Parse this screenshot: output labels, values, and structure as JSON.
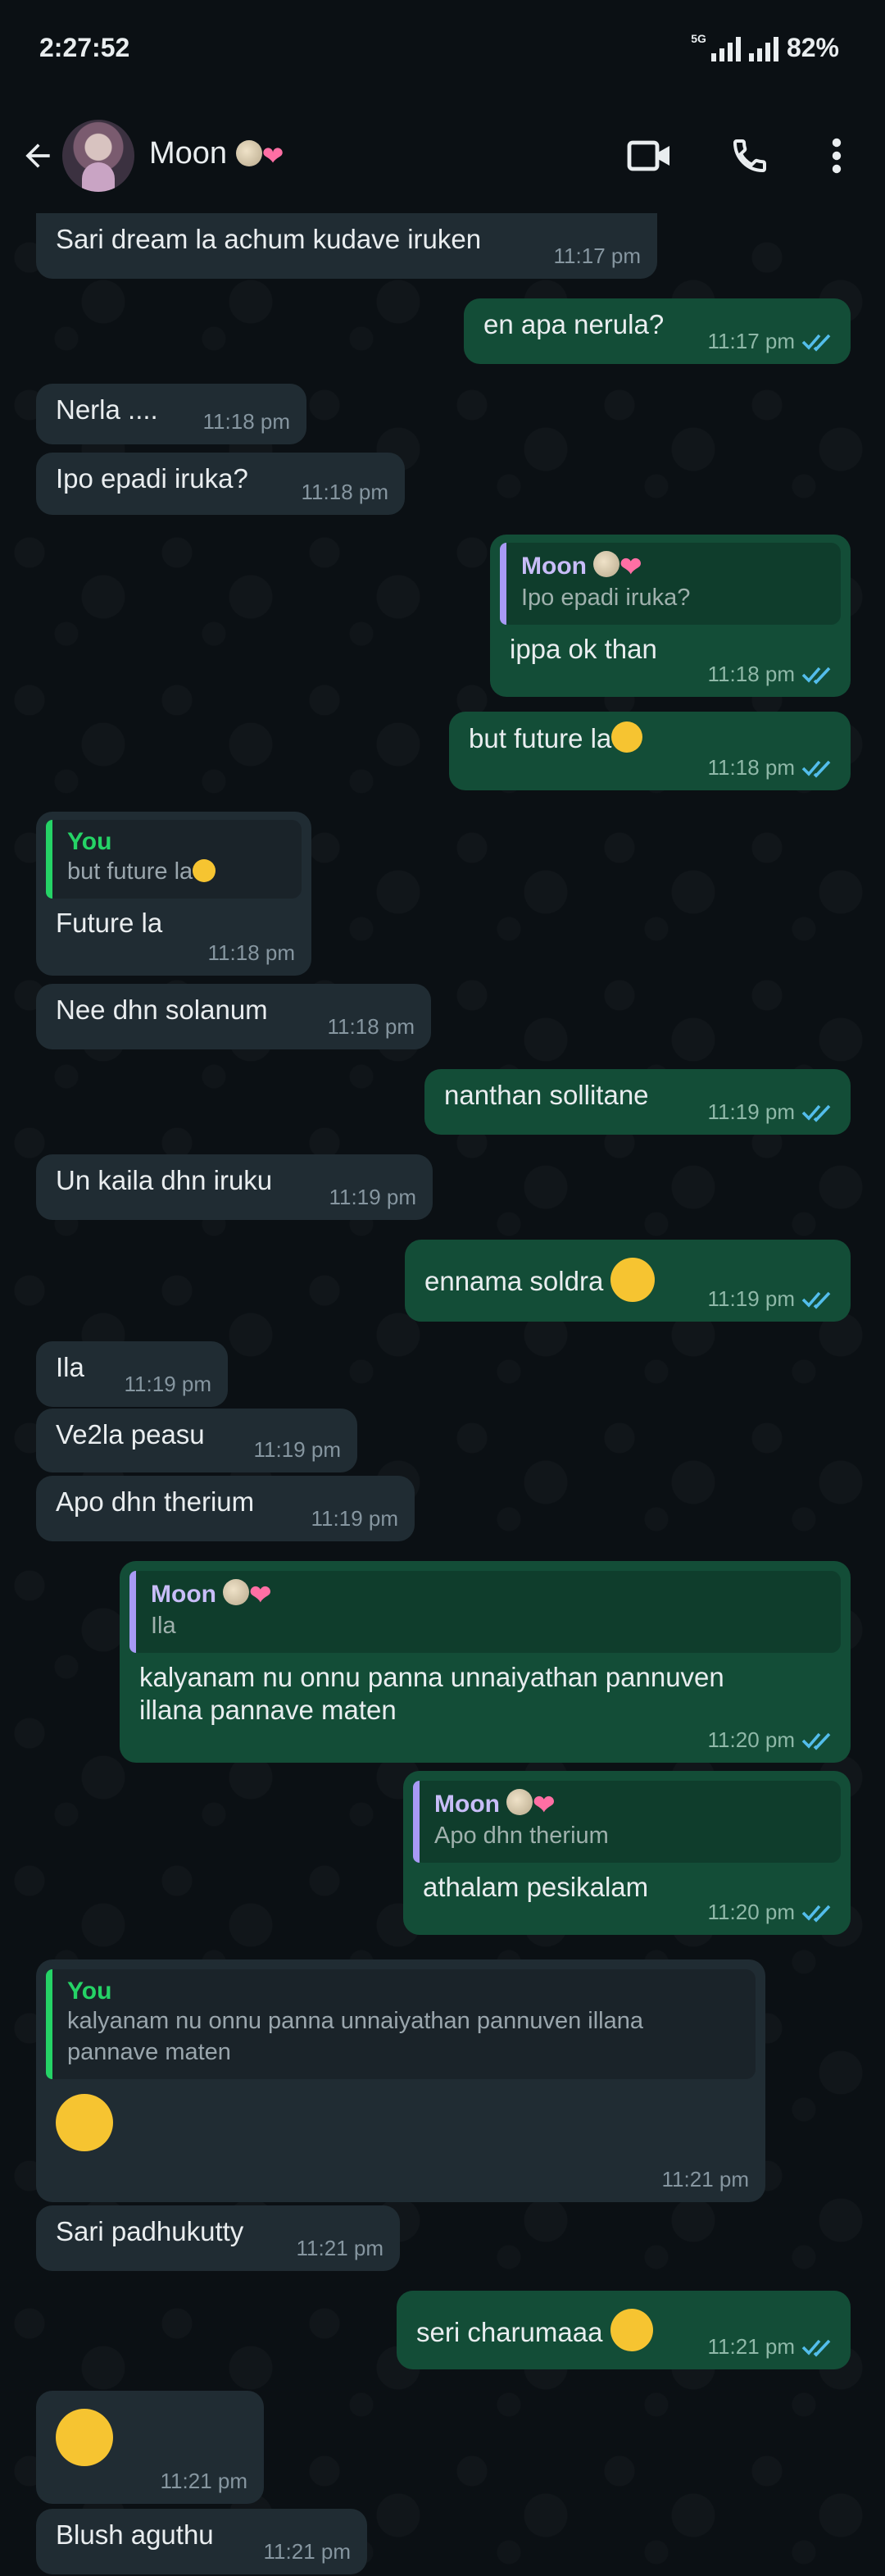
{
  "status": {
    "time": "2:27:52",
    "network": "5G",
    "battery": "82%"
  },
  "header": {
    "contact_name": "Moon",
    "contact_emojis": [
      "moon-emoji",
      "sparkling-heart-emoji"
    ]
  },
  "messages": [
    {
      "dir": "in",
      "text": "Sari dream la achum kudave iruken",
      "time": "11:17 pm"
    },
    {
      "dir": "out",
      "text": "en apa nerula?",
      "time": "11:17 pm"
    },
    {
      "dir": "in",
      "text": "Nerla ....",
      "time": "11:18 pm"
    },
    {
      "dir": "in",
      "text": "Ipo epadi iruka?",
      "time": "11:18 pm"
    },
    {
      "dir": "out",
      "quote_name": "Moon",
      "quote_text": "Ipo epadi iruka?",
      "text": "ippa ok than",
      "time": "11:18 pm"
    },
    {
      "dir": "out",
      "text": "but future la",
      "time": "11:18 pm"
    },
    {
      "dir": "in",
      "quote_name": "You",
      "quote_text": "but future la",
      "text": "Future la",
      "time": "11:18 pm"
    },
    {
      "dir": "in",
      "text": "Nee dhn solanum",
      "time": "11:18 pm"
    },
    {
      "dir": "out",
      "text": "nanthan sollitane",
      "time": "11:19 pm"
    },
    {
      "dir": "in",
      "text": "Un kaila dhn iruku",
      "time": "11:19 pm"
    },
    {
      "dir": "out",
      "text": "ennama soldra",
      "time": "11:19 pm"
    },
    {
      "dir": "in",
      "text": "Ila",
      "time": "11:19 pm"
    },
    {
      "dir": "in",
      "text": "Ve2la peasu",
      "time": "11:19 pm"
    },
    {
      "dir": "in",
      "text": "Apo dhn therium",
      "time": "11:19 pm"
    },
    {
      "dir": "out",
      "quote_name": "Moon",
      "quote_text": "Ila",
      "text": "kalyanam nu onnu panna unnaiyathan pannuven illana pannave maten",
      "time": "11:20 pm"
    },
    {
      "dir": "out",
      "quote_name": "Moon",
      "quote_text": "Apo dhn therium",
      "text": "athalam pesikalam",
      "time": "11:20 pm"
    },
    {
      "dir": "in",
      "quote_name": "You",
      "quote_text": "kalyanam nu onnu panna unnaiyathan pannuven illana pannave maten",
      "text": "",
      "time": "11:21 pm"
    },
    {
      "dir": "in",
      "text": "Sari padhukutty",
      "time": "11:21 pm"
    },
    {
      "dir": "out",
      "text": "seri charumaaa",
      "time": "11:21 pm"
    },
    {
      "dir": "in",
      "text": "",
      "time": "11:21 pm"
    },
    {
      "dir": "in",
      "text": "Blush aguthu",
      "time": "11:21 pm"
    }
  ],
  "colors": {
    "incoming": "#202c33",
    "outgoing": "#134d37",
    "read_ticks": "#53bdeb",
    "you_accent": "#25d366",
    "moon_accent": "#a89af5"
  }
}
